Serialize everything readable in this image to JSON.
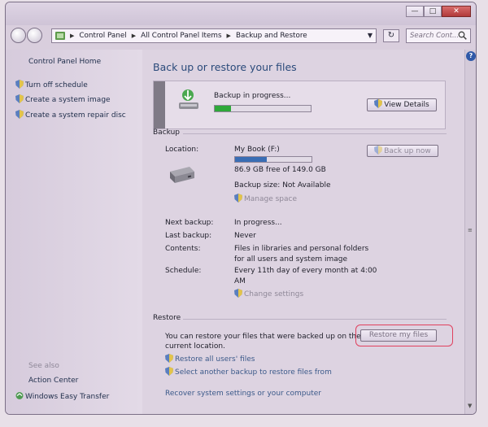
{
  "window": {
    "controls": {
      "minimize": "—",
      "maximize": "□",
      "close": "✕"
    }
  },
  "nav": {
    "breadcrumb": [
      "Control Panel",
      "All Control Panel Items",
      "Backup and Restore"
    ],
    "search_placeholder": "Search Cont..."
  },
  "sidebar": {
    "home": "Control Panel Home",
    "items": [
      "Turn off schedule",
      "Create a system image",
      "Create a system repair disc"
    ],
    "see_also_heading": "See also",
    "see_also": [
      "Action Center",
      "Windows Easy Transfer"
    ]
  },
  "main": {
    "title": "Back up or restore your files",
    "progress": {
      "label": "Backup in progress...",
      "fraction": 0.17,
      "view_details_label": "View Details"
    },
    "backup": {
      "heading": "Backup",
      "location_label": "Location:",
      "drive_name": "My Book (F:)",
      "drive_used_fraction": 0.42,
      "free_space": "86.9 GB free of 149.0 GB",
      "backup_size": "Backup size: Not Available",
      "manage_space": "Manage space",
      "backup_now": "Back up now",
      "next_backup_label": "Next backup:",
      "next_backup_value": "In progress...",
      "last_backup_label": "Last backup:",
      "last_backup_value": "Never",
      "contents_label": "Contents:",
      "contents_value": [
        "Files in libraries and personal folders",
        "for all users and system image"
      ],
      "schedule_label": "Schedule:",
      "schedule_value": [
        "Every 11th day of every month at 4:00",
        "AM"
      ],
      "change_settings": "Change settings"
    },
    "restore": {
      "heading": "Restore",
      "description": [
        "You can restore your files that were backed up on the",
        "current location."
      ],
      "restore_button": "Restore my files",
      "restore_all_users": "Restore all users' files",
      "select_another": "Select another backup to restore files from",
      "recover_link": "Recover system settings or your computer"
    }
  },
  "colors": {
    "progress_green": "#2fa83a",
    "drive_bar_blue": "#3a6db4",
    "highlight_pink": "#e0405e"
  }
}
